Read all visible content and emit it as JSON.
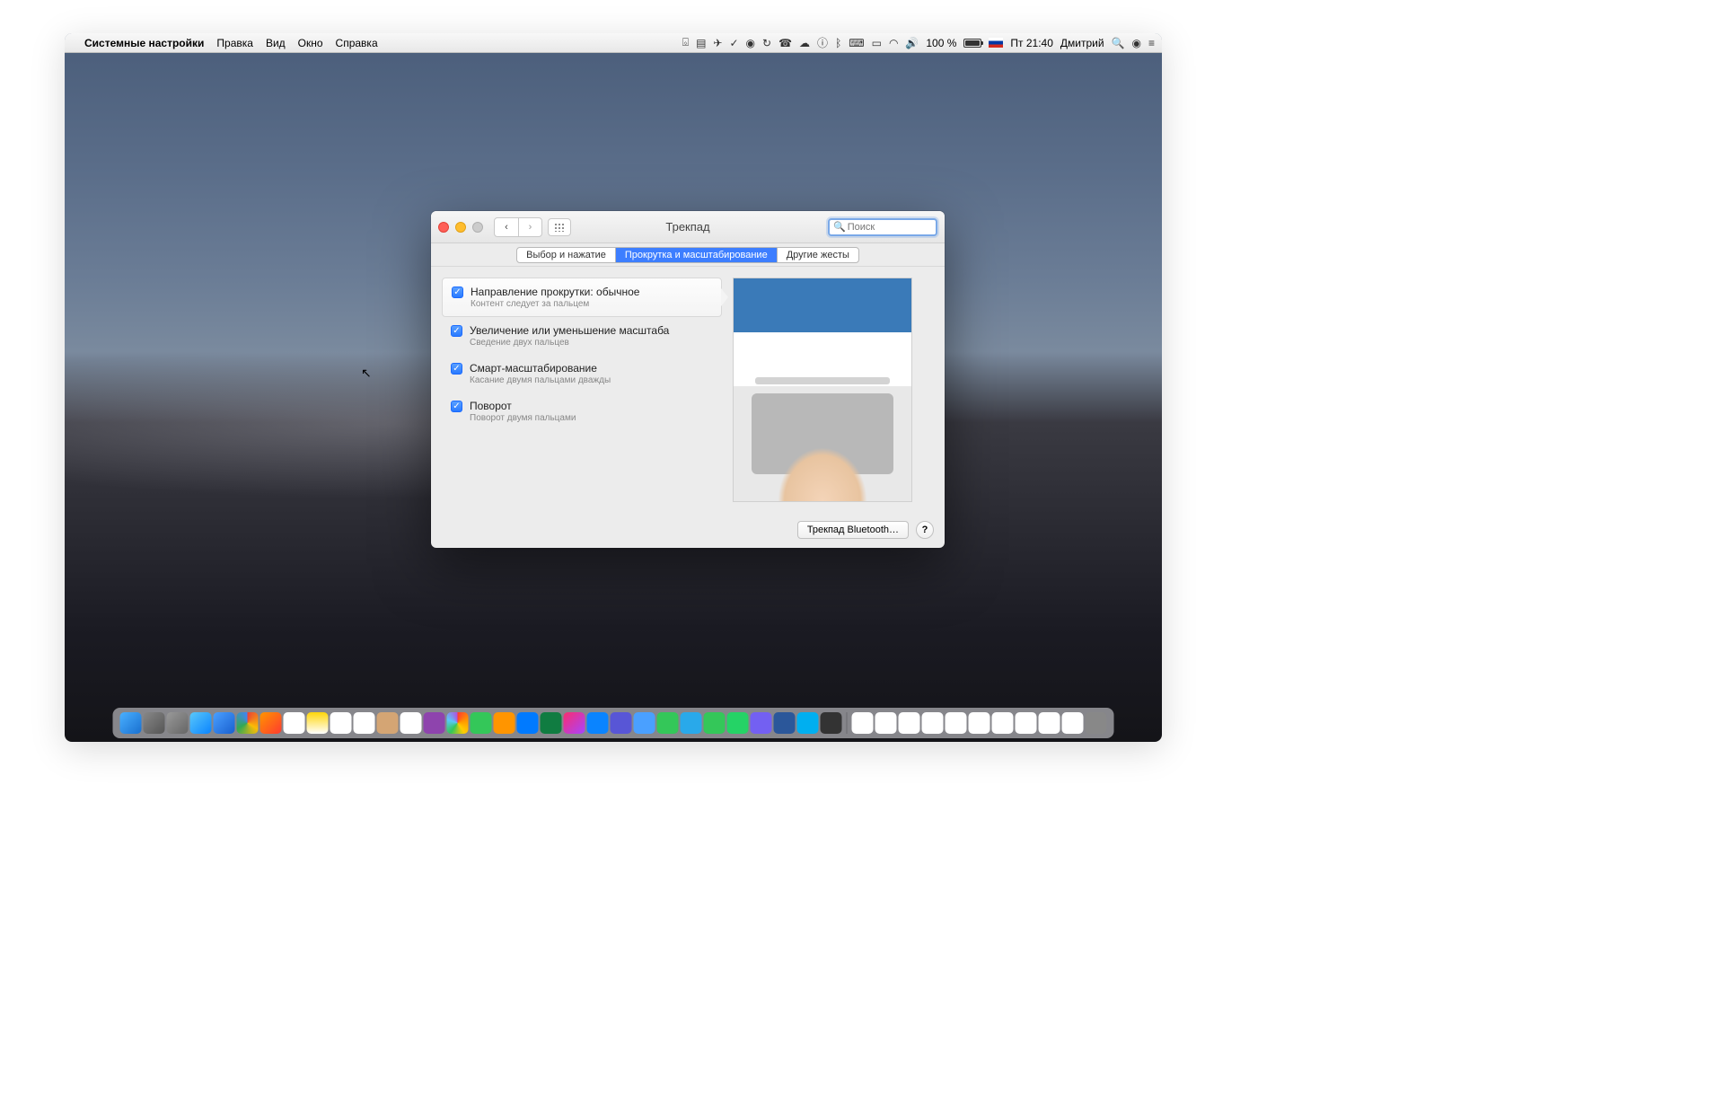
{
  "menubar": {
    "app_name": "Системные настройки",
    "menus": [
      "Правка",
      "Вид",
      "Окно",
      "Справка"
    ],
    "battery_pct": "100 %",
    "clock": "Пт 21:40",
    "user": "Дмитрий"
  },
  "window": {
    "title": "Трекпад",
    "search_placeholder": "Поиск",
    "tabs": [
      {
        "label": "Выбор и нажатие",
        "active": false
      },
      {
        "label": "Прокрутка и масштабирование",
        "active": true
      },
      {
        "label": "Другие жесты",
        "active": false
      }
    ],
    "options": [
      {
        "checked": true,
        "title": "Направление прокрутки: обычное",
        "sub": "Контент следует за пальцем",
        "selected": true
      },
      {
        "checked": true,
        "title": "Увеличение или уменьшение масштаба",
        "sub": "Сведение двух пальцев",
        "selected": false
      },
      {
        "checked": true,
        "title": "Смарт-масштабирование",
        "sub": "Касание двумя пальцами дважды",
        "selected": false
      },
      {
        "checked": true,
        "title": "Поворот",
        "sub": "Поворот двумя пальцами",
        "selected": false
      }
    ],
    "bt_button": "Трекпад Bluetooth…",
    "help": "?"
  }
}
